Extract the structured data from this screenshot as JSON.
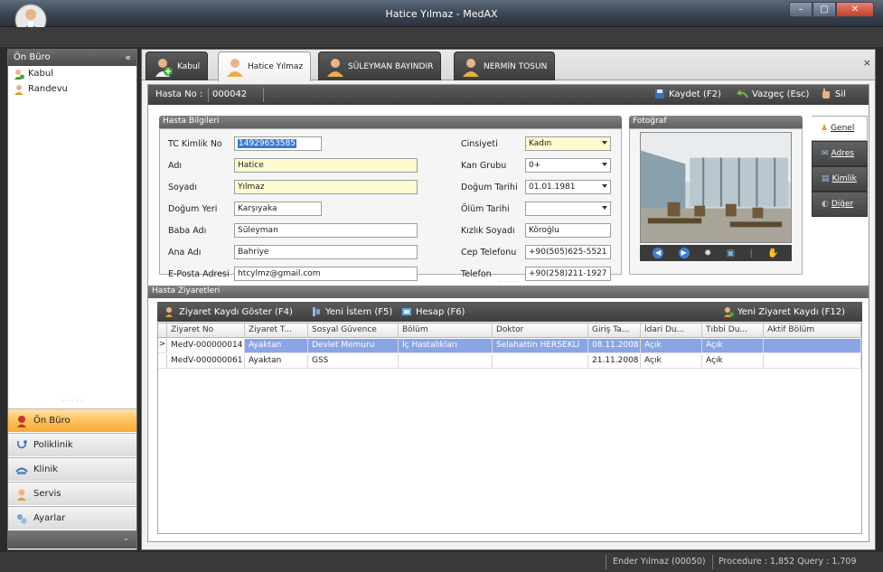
{
  "window": {
    "title": "Hatice Yılmaz - MedAX",
    "minimize": "–",
    "maximize": "□",
    "close": "✕"
  },
  "sidebar": {
    "header": "Ön Büro",
    "collapse": "«",
    "items": [
      {
        "label": "Kabul",
        "icon": "user-add-icon"
      },
      {
        "label": "Randevu",
        "icon": "appointment-icon"
      }
    ],
    "nav": [
      {
        "label": "Ön Büro",
        "icon": "front-desk-icon",
        "active": true
      },
      {
        "label": "Poliklinik",
        "icon": "stethoscope-icon",
        "active": false
      },
      {
        "label": "Klinik",
        "icon": "clinic-icon",
        "active": false
      },
      {
        "label": "Servis",
        "icon": "service-icon",
        "active": false
      },
      {
        "label": "Ayarlar",
        "icon": "settings-icon",
        "active": false
      }
    ],
    "more": "⌄"
  },
  "tabs": [
    {
      "label": "Kabul",
      "active": false
    },
    {
      "label": "Hatice Yılmaz",
      "active": true
    },
    {
      "label": "SÜLEYMAN BAYINDIR",
      "active": false
    },
    {
      "label": "NERMİN TOSUN",
      "active": false
    }
  ],
  "tabs_close": "×",
  "toolbar": {
    "hasta_no_label": "Hasta No :",
    "hasta_no": "000042",
    "save": "Kaydet (F2)",
    "cancel": "Vazgeç (Esc)",
    "delete": "Sil"
  },
  "patient_info": {
    "title": "Hasta Bilgileri",
    "fields": {
      "tc_label": "TC Kimlik No",
      "tc": "14929653585",
      "adi_label": "Adı",
      "adi": "Hatice",
      "soyadi_label": "Soyadı",
      "soyadi": "Yılmaz",
      "dogum_yeri_label": "Doğum Yeri",
      "dogum_yeri": "Karşıyaka",
      "baba_label": "Baba Adı",
      "baba": "Süleyman",
      "ana_label": "Ana Adı",
      "ana": "Bahriye",
      "email_label": "E-Posta Adresi",
      "email": "htcylmz@gmail.com",
      "cinsiyet_label": "Cinsiyeti",
      "cinsiyet": "Kadın",
      "kan_label": "Kan Grubu",
      "kan": "0+",
      "dogum_tarihi_label": "Doğum Tarihi",
      "dogum_tarihi": "01.01.1981",
      "olum_label": "Ölüm Tarihi",
      "olum": "",
      "kizlik_label": "Kızlık Soyadı",
      "kizlik": "Köroğlu",
      "cep_label": "Cep Telefonu",
      "cep": "+90(505)625-5521",
      "tel_label": "Telefon",
      "tel": "+90(258)211-1927"
    }
  },
  "photo": {
    "title": "Fotoğraf"
  },
  "side_tabs": [
    {
      "label": "Genel",
      "active": true
    },
    {
      "label": "Adres",
      "active": false
    },
    {
      "label": "Kimlik",
      "active": false
    },
    {
      "label": "Diğer",
      "active": false
    }
  ],
  "visits": {
    "title": "Hasta Ziyaretleri",
    "actions": {
      "show": "Ziyaret Kaydı Göster (F4)",
      "new_request": "Yeni İstem (F5)",
      "account": "Hesap (F6)",
      "new_visit": "Yeni Ziyaret Kaydı (F12)"
    },
    "columns": [
      "Ziyaret No",
      "Ziyaret T...",
      "Sosyal Güvence",
      "Bölüm",
      "Doktor",
      "Giriş Ta...",
      "İdari Du...",
      "Tıbbi Du...",
      "Aktif Bölüm"
    ],
    "rows": [
      [
        "MedV-000000014",
        "Ayaktan",
        "Devlet Memuru",
        "İç Hastalıkları",
        "Selahattin HERSEKLİ",
        "08.11.2008",
        "Açık",
        "Açık",
        ""
      ],
      [
        "MedV-000000061",
        "Ayaktan",
        "GSS",
        "",
        "",
        "21.11.2008",
        "Açık",
        "Açık",
        ""
      ]
    ],
    "selected_marker": ">"
  },
  "status": {
    "user": "Ender Yılmaz (00050)",
    "stats": "Procedure : 1,852  Query : 1,709"
  }
}
